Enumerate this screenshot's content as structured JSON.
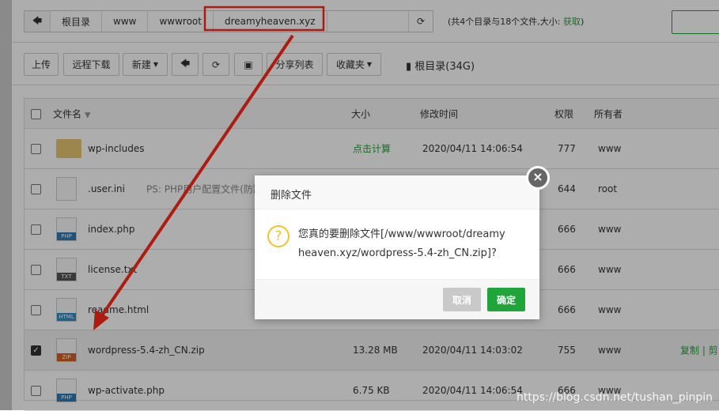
{
  "breadcrumb": {
    "items": [
      "根目录",
      "www",
      "wwwroot",
      "dreamyheaven.xyz"
    ]
  },
  "summary": {
    "text": "(共4个目录与18个文件,大小: ",
    "link": "获取",
    "end": ")"
  },
  "toolbar": {
    "upload": "上传",
    "remote_download": "远程下载",
    "new": "新建",
    "share_list": "分享列表",
    "favorites": "收藏夹",
    "disk": "根目录(34G)"
  },
  "table": {
    "headers": {
      "name": "文件名",
      "size": "大小",
      "mtime": "修改时间",
      "perm": "权限",
      "owner": "所有者"
    },
    "rows": [
      {
        "name": "wp-includes",
        "size": "点击计算",
        "mtime": "2020/04/11 14:06:54",
        "perm": "777",
        "owner": "www",
        "type": "folder"
      },
      {
        "name": ".user.ini",
        "note": "PS: PHP用户配置文件(防跨",
        "size": "",
        "mtime": "",
        "perm": "644",
        "owner": "root",
        "type": "blank"
      },
      {
        "name": "index.php",
        "size": "",
        "mtime": "",
        "perm": "666",
        "owner": "www",
        "type": "PHP"
      },
      {
        "name": "license.txt",
        "size": "",
        "mtime": "",
        "perm": "666",
        "owner": "www",
        "type": "TXT"
      },
      {
        "name": "readme.html",
        "size": "",
        "mtime": "",
        "perm": "666",
        "owner": "www",
        "type": "HTML"
      },
      {
        "name": "wordpress-5.4-zh_CN.zip",
        "size": "13.28 MB",
        "mtime": "2020/04/11 14:03:02",
        "perm": "755",
        "owner": "www",
        "type": "ZIP",
        "checked": true,
        "actions": "复制 | 剪"
      },
      {
        "name": "wp-activate.php",
        "size": "6.75 KB",
        "mtime": "2020/04/11 14:06:54",
        "perm": "666",
        "owner": "www",
        "type": "PHP"
      }
    ]
  },
  "modal": {
    "title": "删除文件",
    "message_line1": "您真的要删除文件[/www/wwwroot/dreamy",
    "message_line2": "heaven.xyz/wordpress-5.4-zh_CN.zip]?",
    "cancel": "取消",
    "confirm": "确定"
  },
  "watermark": "https://blog.csdn.net/tushan_pinpin",
  "colors": {
    "accent": "#20a53a",
    "annotation": "#ff2a1a"
  }
}
